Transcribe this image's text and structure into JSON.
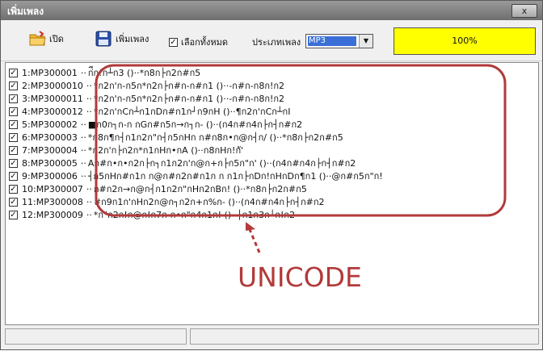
{
  "window": {
    "title": "เพิ่มเพลง",
    "close_label": "x"
  },
  "toolbar": {
    "open_label": "เปิด",
    "add_label": "เพิ่มเพลง",
    "select_all_label": "เลือกทั้งหมด",
    "select_all_checked": true,
    "type_label": "ประเภทเพลง",
    "type_value": "MP3",
    "progress_text": "100%",
    "progress_value": 1.0
  },
  "songs": [
    {
      "index": "1",
      "code": "MP300001",
      "title": "ก่ีก!ก┴ก3 ()··*ก8ก├ก2ก#ก5"
    },
    {
      "index": "2",
      "code": "MP3000010",
      "title": "*ก2ก'ก-ก5ก*ก2ก├ก#ก-ก#ก1 ()··-ก#ก-ก8ก!ก2"
    },
    {
      "index": "3",
      "code": "MP3000011",
      "title": "*ก2ก'ก-ก5ก*ก2ก├ก#ก-ก#ก1 ()··-ก#ก-ก8ก!ก2"
    },
    {
      "index": "4",
      "code": "MP3000012",
      "title": "*ก2ก'กCก┴ก1กDก#ก1ก┘ก9กH ()··¶ก2ก'กCก┴กI"
    },
    {
      "index": "5",
      "code": "MP300002",
      "title": "■ก0ก┐ก-ก  กGก#ก5ก→ก┐ก- ()··(ก4ก#ก4ก├ก┤ก#ก2"
    },
    {
      "index": "6",
      "code": "MP300003",
      "title": "*ก8ก¶ก┤ก1ก2ก\"ก┤ก5กHก  ก#ก8ก•ก@ก┤ก/ ()··*ก8ก├ก2ก#ก5"
    },
    {
      "index": "7",
      "code": "MP300004",
      "title": "*ก2ก'ก├ก2ก*ก1กHก•กA ()··ก8กHก!กั'"
    },
    {
      "index": "8",
      "code": "MP300005",
      "title": "Aก#ก•ก•ก2ก├ก┐ก1ก2ก'ก@ก+ก├ก5ก\"ก' ()··(ก4ก#ก4ก├ก┤ก#ก2"
    },
    {
      "index": "9",
      "code": "MP300006",
      "title": "┤ก5กHก#ก1ก  ก@ก#ก2ก#ก1ก  ก  ก1ก├กDก!กHกDก¶ก1 ()··@ก#ก5ก\"ก!"
    },
    {
      "index": "10",
      "code": "MP300007",
      "title": "  ก#ก2ก→ก@ก┤ก1ก2ก\"กHก2กBก! ()··*ก8ก├ก2ก#ก5"
    },
    {
      "index": "11",
      "code": "MP300008",
      "title": "#ก9ก1ก'กHก2ก@ก┐ก2ก+ก%ก- ()··(ก4ก#ก4ก├ก┤ก#ก2"
    },
    {
      "index": "12",
      "code": "MP300009",
      "title": "*ก\"ก2ก!ก@ก!ก7ก-ก•ก\"ก4ก1ก! ()··├ก1ก3ก┘ก!ก2"
    }
  ],
  "annotation": {
    "label": "UNICODE"
  },
  "colors": {
    "annotation": "#b23a3a",
    "progress": "#ffff00",
    "select_highlight": "#3a6fd8"
  }
}
